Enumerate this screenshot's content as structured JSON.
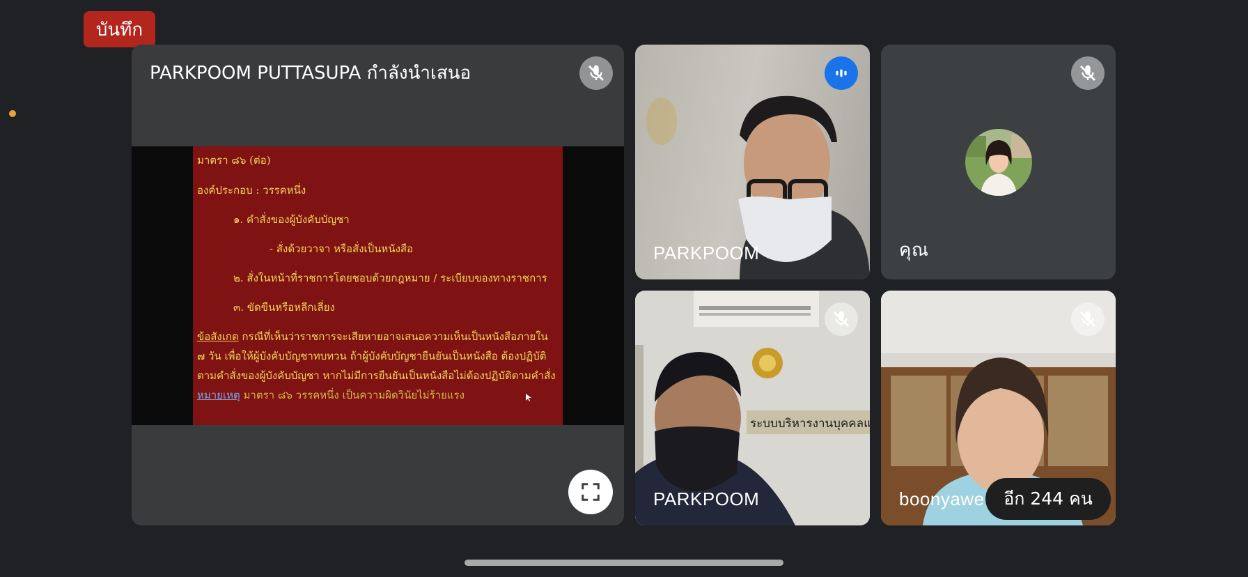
{
  "recording_badge": "บันทึก",
  "presentation": {
    "title": "PARKPOOM PUTTASUPA กำลังนำเสนอ",
    "slide": {
      "heading": "มาตรา ๘๖ (ต่อ)",
      "elements_label": "องค์ประกอบ : วรรคหนึ่ง",
      "item1": "๑. คำสั่งของผู้บังคับบัญชา",
      "item1_sub": "- สั่งด้วยวาจา หรือสั่งเป็นหนังสือ",
      "item2": "๒. สั่งในหน้าที่ราชการโดยชอบด้วยกฎหมาย / ระเบียบของทางราชการ",
      "item3": "๓. ขัดขืนหรือหลีกเลี่ยง",
      "note_label": "ข้อสังเกต",
      "note_line1": " กรณีที่เห็นว่าราชการจะเสียหายอาจเสนอความเห็นเป็นหนังสือภายใน",
      "note_line2": "๗ วัน เพื่อให้ผู้บังคับบัญชาทบทวน ถ้าผู้บังคับบัญชายืนยันเป็นหนังสือ ต้องปฏิบัติ",
      "note_line3": "ตามคำสั่งของผู้บังคับบัญชา หากไม่มีการยืนยันเป็นหนังสือไม่ต้องปฏิบัติตามคำสั่ง",
      "remark_label": "หมายเหตุ",
      "remark_text": "  มาตรา ๘๖ วรรคหนึ่ง เป็นความผิดวินัยไม่ร้ายแรง"
    }
  },
  "participants": [
    {
      "name": "PARKPOOM",
      "state": "speaking"
    },
    {
      "name": "คุณ",
      "state": "muted"
    },
    {
      "name": "PARKPOOM",
      "state": "muted"
    },
    {
      "name": "boonyawe",
      "state": "muted"
    }
  ],
  "more_participants": "อีก 244 คน",
  "icons": {
    "mic_off": "mic-off-icon",
    "speaking": "audio-level-icon",
    "fullscreen": "fullscreen-icon"
  },
  "colors": {
    "background": "#202124",
    "tile": "#3c4043",
    "record": "#b3261e",
    "speaking": "#1a73e8",
    "slide_bg": "#7f1212",
    "slide_text": "#f2d65a"
  }
}
